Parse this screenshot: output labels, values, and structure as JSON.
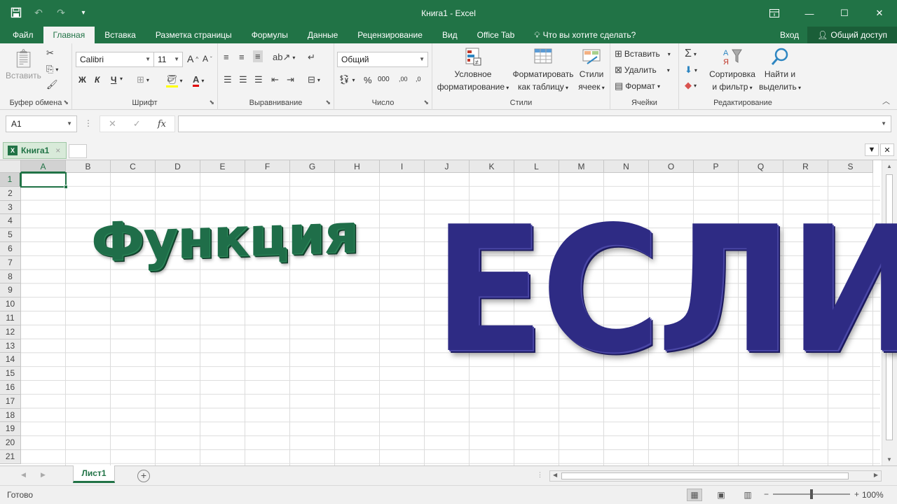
{
  "window": {
    "title": "Книга1 - Excel"
  },
  "qat": {
    "save_icon": "save-icon",
    "undo_icon": "undo-icon",
    "redo_icon": "redo-icon",
    "customize_icon": "customize-icon"
  },
  "tabs": [
    "Файл",
    "Главная",
    "Вставка",
    "Разметка страницы",
    "Формулы",
    "Данные",
    "Рецензирование",
    "Вид",
    "Office Tab"
  ],
  "tell_me": "Что вы хотите сделать?",
  "signin": "Вход",
  "share": "Общий доступ",
  "ribbon": {
    "clipboard": {
      "paste": "Вставить",
      "label": "Буфер обмена"
    },
    "font": {
      "name": "Calibri",
      "size": "11",
      "bold": "Ж",
      "italic": "К",
      "underline": "Ч",
      "grow": "A",
      "shrink": "A",
      "label": "Шрифт"
    },
    "alignment": {
      "label": "Выравнивание"
    },
    "number": {
      "format": "Общий",
      "percent": "%",
      "thousands": "000",
      "inc_dec": ",00",
      "dec_dec": ",0",
      "label": "Число"
    },
    "styles": {
      "conditional_1": "Условное",
      "conditional_2": "форматирование",
      "table_1": "Форматировать",
      "table_2": "как таблицу",
      "cell_1": "Стили",
      "cell_2": "ячеек",
      "label": "Стили"
    },
    "cells": {
      "insert": "Вставить",
      "delete": "Удалить",
      "format": "Формат",
      "label": "Ячейки"
    },
    "editing": {
      "sort_1": "Сортировка",
      "sort_2": "и фильтр",
      "find_1": "Найти и",
      "find_2": "выделить",
      "label": "Редактирование"
    }
  },
  "formula_bar": {
    "name_box": "A1",
    "cancel": "✕",
    "enter": "✓",
    "fx": "fx",
    "formula": ""
  },
  "workbook_tab": {
    "name": "Книга1",
    "close": "×"
  },
  "columns": [
    "A",
    "B",
    "C",
    "D",
    "E",
    "F",
    "G",
    "H",
    "I",
    "J",
    "K",
    "L",
    "M",
    "N",
    "O",
    "P",
    "Q",
    "R",
    "S"
  ],
  "rows": [
    "1",
    "2",
    "3",
    "4",
    "5",
    "6",
    "7",
    "8",
    "9",
    "10",
    "11",
    "12",
    "13",
    "14",
    "15",
    "16",
    "17",
    "18",
    "19",
    "20",
    "21"
  ],
  "wordart": {
    "left": "Функция",
    "right": "ЕСЛИ"
  },
  "sheets": [
    "Лист1"
  ],
  "status": {
    "text": "Готово",
    "zoom": "100%",
    "minus": "−",
    "plus": "+"
  },
  "colors": {
    "excel_green": "#217346",
    "wordart_green": "#1f6e49",
    "wordart_blue": "#2e2b84"
  }
}
